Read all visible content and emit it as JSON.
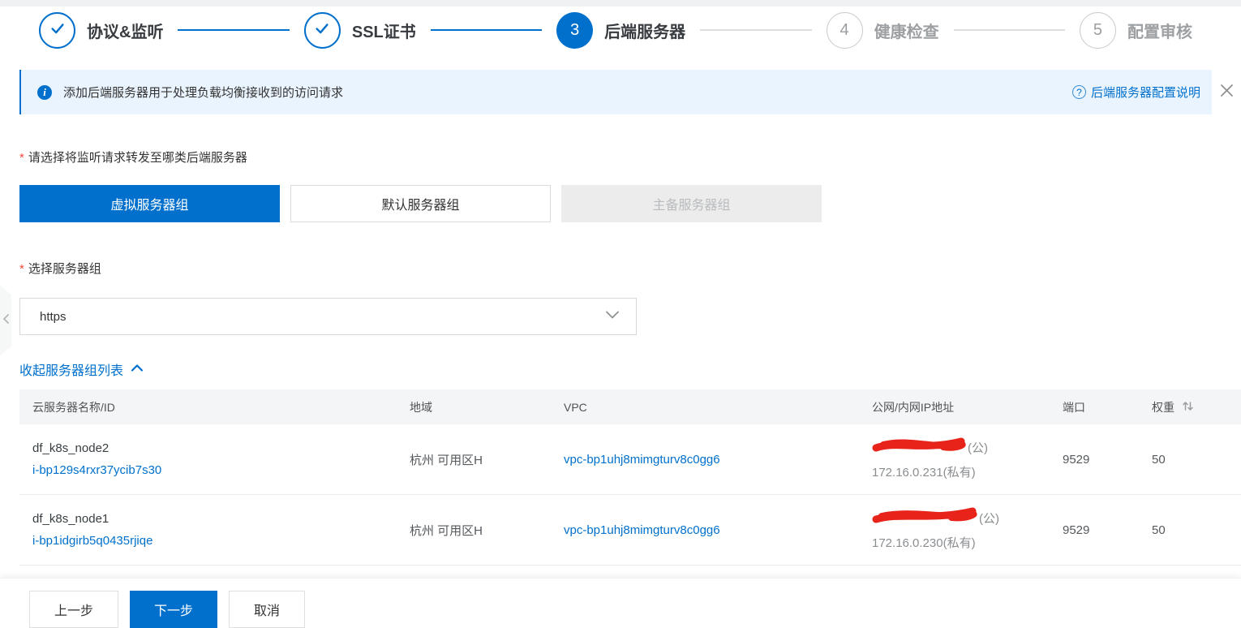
{
  "colors": {
    "primary": "#0070cc",
    "banner_bg": "#e9f4fe",
    "link": "#0070cc",
    "redact_scribble": "#e8231a",
    "disabled_bg": "#ececec",
    "pending_gray": "#9da0a3"
  },
  "icons": {
    "info_glyph": "i",
    "help_glyph": "?",
    "step_done": "check-icon",
    "close": "close-icon",
    "select_chevron": "chevron-down-icon",
    "collapse_chevron": "chevron-up-icon",
    "panel_chevron": "chevron-left-icon",
    "weight_sort": "sort-icon"
  },
  "wizard": {
    "steps": [
      {
        "label": "协议&监听",
        "state": "done"
      },
      {
        "label": "SSL证书",
        "state": "done"
      },
      {
        "label": "后端服务器",
        "state": "current",
        "number": "3"
      },
      {
        "label": "健康检查",
        "state": "pending",
        "number": "4"
      },
      {
        "label": "配置审核",
        "state": "pending",
        "number": "5"
      }
    ]
  },
  "banner": {
    "text": "添加后端服务器用于处理负载均衡接收到的访问请求",
    "help_link": "后端服务器配置说明"
  },
  "form": {
    "required_mark": "*",
    "backend_type": {
      "label": "请选择将监听请求转发至哪类后端服务器",
      "options": [
        {
          "label": "虚拟服务器组",
          "state": "selected"
        },
        {
          "label": "默认服务器组",
          "state": "normal"
        },
        {
          "label": "主备服务器组",
          "state": "disabled"
        }
      ]
    },
    "server_group": {
      "label": "选择服务器组",
      "value": "https"
    },
    "collapse_link": "收起服务器组列表"
  },
  "table": {
    "columns": [
      "云服务器名称/ID",
      "地域",
      "VPC",
      "公网/内网IP地址",
      "端口",
      "权重"
    ],
    "rows": [
      {
        "name": "df_k8s_node2",
        "id": "i-bp129s4rxr37ycib7s30",
        "region": "杭州 可用区H",
        "vpc": "vpc-bp1uhj8mimgturv8c0gg6",
        "public_ip_redacted": true,
        "public_suffix": "(公)",
        "private_ip": "172.16.0.231(私有)",
        "port": "9529",
        "weight": "50"
      },
      {
        "name": "df_k8s_node1",
        "id": "i-bp1idgirb5q0435rjiqe",
        "region": "杭州 可用区H",
        "vpc": "vpc-bp1uhj8mimgturv8c0gg6",
        "public_ip_redacted": true,
        "public_suffix": "(公)",
        "private_ip": "172.16.0.230(私有)",
        "port": "9529",
        "weight": "50"
      }
    ]
  },
  "footer": {
    "prev": "上一步",
    "next": "下一步",
    "cancel": "取消"
  }
}
